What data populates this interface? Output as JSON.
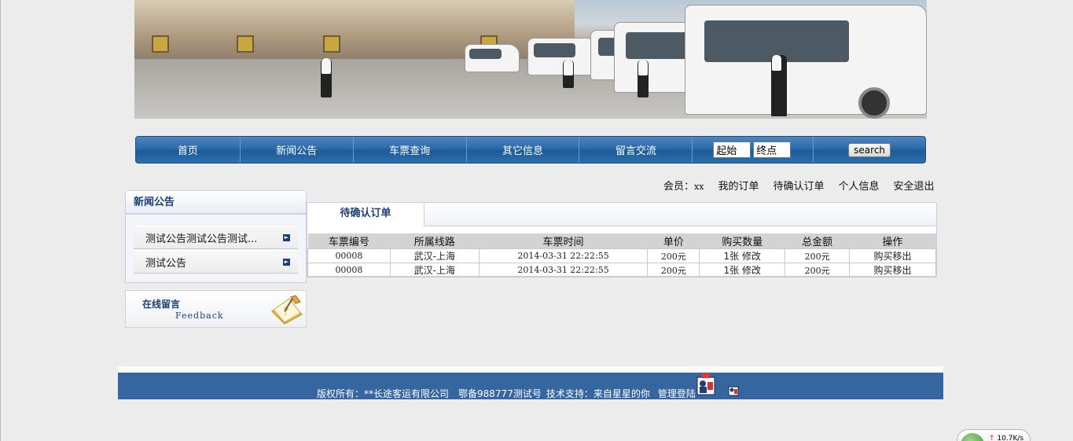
{
  "nav": {
    "items": [
      "首页",
      "新闻公告",
      "车票查询",
      "其它信息",
      "留言交流"
    ],
    "search_from_value": "起始",
    "search_to_value": "终点",
    "search_label": "search"
  },
  "member": {
    "label": "会员：",
    "name": "xx",
    "links": [
      "我的订单",
      "待确认订单",
      "个人信息",
      "安全退出"
    ]
  },
  "news": {
    "title": "新闻公告",
    "items": [
      "测试公告测试公告测试...",
      "测试公告"
    ]
  },
  "feedback": {
    "title": "在线留言",
    "subtitle": "Feedback"
  },
  "orders": {
    "tab_label": "待确认订单",
    "columns": [
      "车票编号",
      "所属线路",
      "车票时间",
      "单价",
      "购买数量",
      "总金额",
      "操作"
    ],
    "rows": [
      {
        "id": "00008",
        "route": "武汉-上海",
        "time": "2014-03-31 22:22:55",
        "price": "200元",
        "qty": "1张",
        "edit": "修改",
        "total": "200元",
        "buy": "购买",
        "remove": "移出"
      },
      {
        "id": "00008",
        "route": "武汉-上海",
        "time": "2014-03-31 22:22:55",
        "price": "200元",
        "qty": "1张",
        "edit": "修改",
        "total": "200元",
        "buy": "购买",
        "remove": "移出"
      }
    ]
  },
  "footer": {
    "copyright": "版权所有：**长途客运有限公司",
    "icp": "鄂备988777测试号",
    "support": "技术支持：来自星星的你",
    "admin_login": "管理登陆"
  },
  "net_widget": {
    "speed": "10.7K/s"
  }
}
